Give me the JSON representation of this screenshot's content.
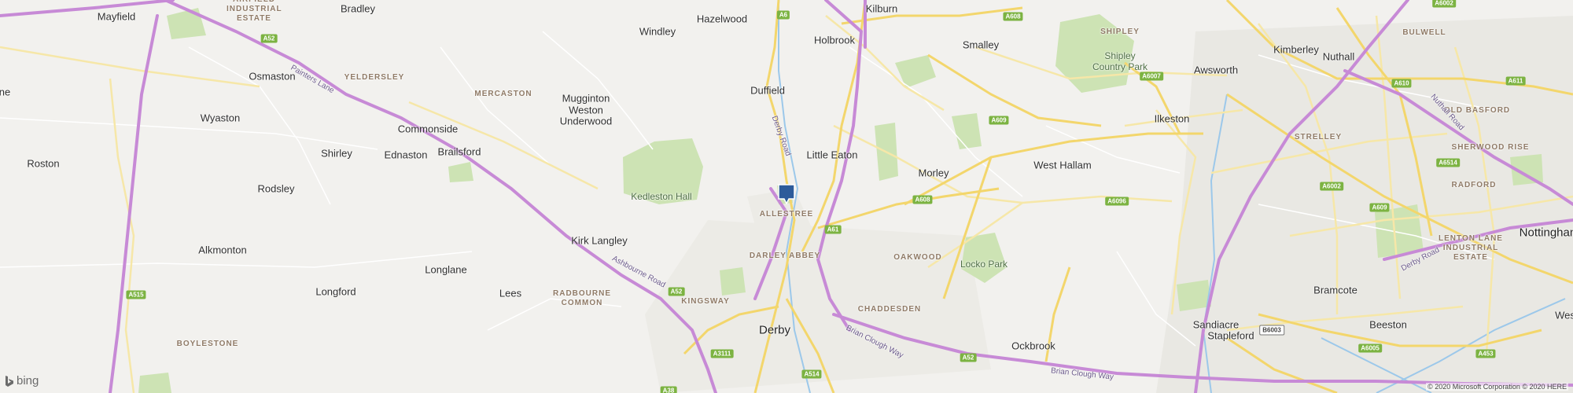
{
  "map": {
    "places": {
      "mayfield": "Mayfield",
      "bradley": "Bradley",
      "windley": "Windley",
      "hazelwood": "Hazelwood",
      "kilburn": "Kilburn",
      "holbrook": "Holbrook",
      "smalley": "Smalley",
      "kimberley": "Kimberley",
      "nuthall": "Nuthall",
      "awsworth": "Awsworth",
      "osmaston": "Osmaston",
      "mugginton": "Mugginton",
      "weston_underwood_1": "Weston",
      "weston_underwood_2": "Underwood",
      "duffield": "Duffield",
      "ilkeston": "Ilkeston",
      "wyaston": "Wyaston",
      "commonside": "Commonside",
      "shirley": "Shirley",
      "ednaston": "Ednaston",
      "brailsford": "Brailsford",
      "little_eaton": "Little Eaton",
      "roston": "Roston",
      "west_hallam": "West Hallam",
      "rodsley": "Rodsley",
      "morley": "Morley",
      "alkmonton": "Alkmonton",
      "kirk_langley": "Kirk Langley",
      "longlane": "Longlane",
      "longford": "Longford",
      "lees": "Lees",
      "derby": "Derby",
      "stapleford": "Stapleford",
      "sandiacre": "Sandiacre",
      "bramcote": "Bramcote",
      "beeston": "Beeston",
      "ockbrook": "Ockbrook",
      "nottingham": "Nottingham",
      "west_edge": "Wes",
      "left_edge": "ne"
    },
    "districts": {
      "airfield": "AIRFIELD INDUSTRIAL ESTATE",
      "yeldersley": "YELDERSLEY",
      "mercaston": "MERCASTON",
      "shipley": "SHIPLEY",
      "bulwell": "BULWELL",
      "old_basford": "OLD BASFORD",
      "strelley": "STRELLEY",
      "sherwood_rise": "SHERWOOD RISE",
      "radford": "RADFORD",
      "allestree": "ALLESTREE",
      "darley_abbey": "DARLEY ABBEY",
      "oakwood": "OAKWOOD",
      "radbourne_common": "RADBOURNE COMMON",
      "kingsway": "KINGSWAY",
      "chaddesden": "CHADDESDEN",
      "boylestone": "BOYLESTONE",
      "lenton_lane": "LENTON LANE INDUSTRIAL ESTATE"
    },
    "parks": {
      "shipley_country_park": "Shipley Country Park",
      "kedleston_hall": "Kedleston Hall",
      "locko_park": "Locko Park"
    },
    "road_names": {
      "painters_lane": "Painters Lane",
      "derby_road_north": "Derby Road",
      "ashbourne_road": "Ashbourne Road",
      "brian_clough_way_1": "Brian Clough Way",
      "brian_clough_way_2": "Brian Clough Way",
      "nuthall_road": "Nuthall Road",
      "derby_road_east": "Derby Road"
    },
    "shields": {
      "a52_west": "A52",
      "a6": "A6",
      "a608_top": "A608",
      "a6007": "A6007",
      "a609_mid": "A609",
      "a608_mid": "A608",
      "a6096": "A6096",
      "a61": "A61",
      "a52_kingsway": "A52",
      "a515": "A515",
      "a3111": "A3111",
      "a514": "A514",
      "a52_east": "A52",
      "a6002_top": "A6002",
      "a610": "A610",
      "a611": "A611",
      "a6514": "A6514",
      "a6002_mid": "A6002",
      "a609_east": "A609",
      "b6003": "B6003",
      "a6005": "A6005",
      "a453": "A453",
      "a38": "A38"
    },
    "brand": "bing",
    "copyright": "© 2020 Microsoft Corporation © 2020 HERE",
    "colors": {
      "background": "#f2f1ee",
      "motorway": "#c78ad6",
      "primary_road": "#f3d66c",
      "park": "#cde3b4",
      "pin": "#2d5b9a"
    },
    "pin_icon": "location-pin-icon"
  }
}
